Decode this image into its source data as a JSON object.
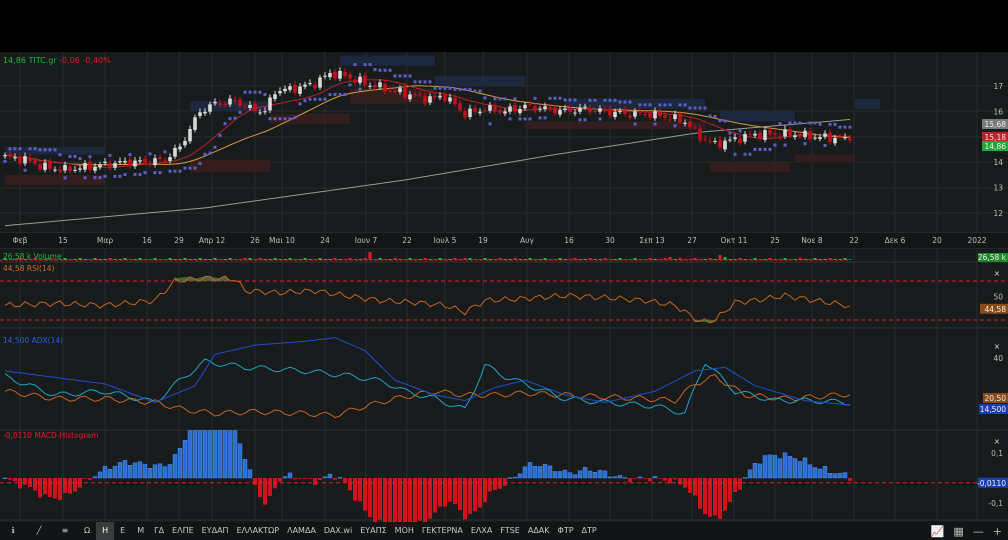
{
  "header": {
    "last": "14,86",
    "symbol": "TITC.gr",
    "change": "-0,06",
    "change_pct": "-0,40%"
  },
  "colors": {
    "up": "#d9d9d9",
    "down": "#c3111b",
    "ma_fast": "#c0202a",
    "ma_mid": "#d99a3a",
    "ma_long": "#9a9a9a",
    "sar": "#5b5fc7",
    "green": "#22b83a",
    "red": "#e0202a",
    "orange": "#c8641e",
    "blue": "#1f4fd0",
    "cyan": "#1fa3c7"
  },
  "chart_data": {
    "type": "candlestick",
    "title": "TITC.gr",
    "x_tick_labels": [
      "Φεβ",
      "15",
      "Μαρ",
      "16",
      "29",
      "Απρ 12",
      "26",
      "Μαι 10",
      "24",
      "Ιουν 7",
      "22",
      "Ιουλ 5",
      "19",
      "Αυγ",
      "16",
      "30",
      "Σεπ 13",
      "27",
      "Οκτ 11",
      "25",
      "Νοε 8",
      "22",
      "Δεκ 6",
      "20",
      "2022"
    ],
    "price_ticks": [
      "17",
      "16",
      "14",
      "13",
      "12"
    ],
    "price_ylim": [
      11.5,
      18.3
    ],
    "n_bars": 170,
    "close_keypoints": [
      [
        0,
        14.2
      ],
      [
        4,
        14.1
      ],
      [
        8,
        13.8
      ],
      [
        12,
        13.7
      ],
      [
        16,
        13.8
      ],
      [
        20,
        13.9
      ],
      [
        24,
        14.0
      ],
      [
        28,
        14.0
      ],
      [
        32,
        14.1
      ],
      [
        35,
        14.6
      ],
      [
        37,
        15.3
      ],
      [
        39,
        16.0
      ],
      [
        42,
        16.3
      ],
      [
        46,
        16.4
      ],
      [
        49,
        16.1
      ],
      [
        52,
        16.0
      ],
      [
        54,
        16.8
      ],
      [
        58,
        16.9
      ],
      [
        62,
        17.1
      ],
      [
        65,
        17.5
      ],
      [
        68,
        17.4
      ],
      [
        72,
        17.1
      ],
      [
        76,
        16.9
      ],
      [
        80,
        16.7
      ],
      [
        84,
        16.5
      ],
      [
        88,
        16.6
      ],
      [
        92,
        15.9
      ],
      [
        96,
        16.1
      ],
      [
        100,
        16.0
      ],
      [
        104,
        16.2
      ],
      [
        108,
        16.1
      ],
      [
        112,
        16.0
      ],
      [
        116,
        16.1
      ],
      [
        120,
        16.0
      ],
      [
        124,
        15.9
      ],
      [
        128,
        15.9
      ],
      [
        132,
        15.8
      ],
      [
        136,
        15.6
      ],
      [
        139,
        15.0
      ],
      [
        142,
        14.7
      ],
      [
        146,
        14.9
      ],
      [
        150,
        15.1
      ],
      [
        154,
        15.1
      ],
      [
        158,
        15.1
      ],
      [
        162,
        15.0
      ],
      [
        166,
        14.95
      ],
      [
        169,
        14.86
      ]
    ],
    "ma_long_keypoints": [
      [
        0,
        11.5
      ],
      [
        40,
        12.2
      ],
      [
        80,
        13.3
      ],
      [
        110,
        14.3
      ],
      [
        140,
        15.2
      ],
      [
        169,
        15.68
      ]
    ],
    "zones_supply": [
      [
        0,
        20,
        14.6,
        14.3
      ],
      [
        37,
        53,
        16.4,
        16.0
      ],
      [
        67,
        86,
        18.2,
        17.8
      ],
      [
        86,
        104,
        17.4,
        17.0
      ],
      [
        112,
        140,
        16.5,
        16.1
      ],
      [
        143,
        158,
        16.0,
        15.6
      ],
      [
        170,
        175,
        16.5,
        16.1
      ]
    ],
    "zones_demand": [
      [
        0,
        20,
        13.5,
        13.1
      ],
      [
        37,
        53,
        14.1,
        13.6
      ],
      [
        53,
        69,
        15.9,
        15.5
      ],
      [
        69,
        86,
        16.9,
        16.3
      ],
      [
        104,
        140,
        15.6,
        15.3
      ],
      [
        141,
        157,
        14.0,
        13.6
      ],
      [
        158,
        170,
        14.3,
        14.0
      ]
    ],
    "price_badges": [
      {
        "value": "15,68",
        "color": "#7a7a7a"
      },
      {
        "value": "15,18",
        "color": "#c0202a"
      },
      {
        "value": "14,86",
        "color": "#22a83a"
      }
    ],
    "volume": {
      "label": "26,58 k Volume",
      "badge": "26,58 k",
      "spikes": [
        [
          73,
          8
        ],
        [
          133,
          3
        ],
        [
          143,
          5
        ],
        [
          144,
          3
        ],
        [
          49,
          2
        ],
        [
          92,
          2
        ]
      ]
    },
    "rsi": {
      "label": "44,58 RSI(14)",
      "badge": "44,58",
      "ticks": [
        "50"
      ],
      "upper": 70,
      "lower": 30,
      "keypoints": [
        [
          0,
          45
        ],
        [
          10,
          47
        ],
        [
          20,
          45
        ],
        [
          30,
          50
        ],
        [
          34,
          70
        ],
        [
          40,
          73
        ],
        [
          46,
          72
        ],
        [
          48,
          60
        ],
        [
          55,
          58
        ],
        [
          62,
          60
        ],
        [
          68,
          55
        ],
        [
          75,
          50
        ],
        [
          82,
          48
        ],
        [
          88,
          45
        ],
        [
          92,
          38
        ],
        [
          96,
          50
        ],
        [
          104,
          52
        ],
        [
          112,
          55
        ],
        [
          120,
          53
        ],
        [
          128,
          50
        ],
        [
          134,
          45
        ],
        [
          139,
          28
        ],
        [
          142,
          30
        ],
        [
          146,
          48
        ],
        [
          150,
          50
        ],
        [
          156,
          55
        ],
        [
          162,
          50
        ],
        [
          169,
          44.58
        ]
      ]
    },
    "adx": {
      "label": "14,500 ADX(14)",
      "ticks": [
        "40"
      ],
      "badges": [
        "20,50",
        "14,500"
      ],
      "adx_keypoints": [
        [
          0,
          33
        ],
        [
          20,
          26
        ],
        [
          30,
          16
        ],
        [
          38,
          25
        ],
        [
          42,
          42
        ],
        [
          50,
          47
        ],
        [
          60,
          49
        ],
        [
          66,
          51
        ],
        [
          72,
          44
        ],
        [
          78,
          28
        ],
        [
          86,
          20
        ],
        [
          92,
          17
        ],
        [
          98,
          24
        ],
        [
          104,
          28
        ],
        [
          112,
          20
        ],
        [
          120,
          16
        ],
        [
          130,
          22
        ],
        [
          138,
          33
        ],
        [
          144,
          35
        ],
        [
          150,
          25
        ],
        [
          160,
          17
        ],
        [
          169,
          14.5
        ]
      ],
      "pdi_keypoints": [
        [
          0,
          30
        ],
        [
          10,
          20
        ],
        [
          20,
          22
        ],
        [
          30,
          16
        ],
        [
          35,
          28
        ],
        [
          40,
          38
        ],
        [
          48,
          35
        ],
        [
          60,
          33
        ],
        [
          70,
          30
        ],
        [
          76,
          27
        ],
        [
          80,
          22
        ],
        [
          86,
          18
        ],
        [
          92,
          12
        ],
        [
          96,
          36
        ],
        [
          100,
          30
        ],
        [
          106,
          24
        ],
        [
          112,
          18
        ],
        [
          120,
          16
        ],
        [
          130,
          14
        ],
        [
          136,
          10
        ],
        [
          140,
          38
        ],
        [
          146,
          22
        ],
        [
          154,
          17
        ],
        [
          160,
          17
        ],
        [
          169,
          16
        ]
      ],
      "mdi_keypoints": [
        [
          0,
          22
        ],
        [
          10,
          18
        ],
        [
          20,
          18
        ],
        [
          30,
          16
        ],
        [
          36,
          12
        ],
        [
          42,
          10
        ],
        [
          50,
          11
        ],
        [
          60,
          10
        ],
        [
          66,
          9
        ],
        [
          72,
          14
        ],
        [
          78,
          18
        ],
        [
          86,
          22
        ],
        [
          92,
          20
        ],
        [
          98,
          20
        ],
        [
          104,
          21
        ],
        [
          112,
          20
        ],
        [
          120,
          19
        ],
        [
          128,
          18
        ],
        [
          134,
          17
        ],
        [
          138,
          26
        ],
        [
          142,
          30
        ],
        [
          148,
          20
        ],
        [
          156,
          18
        ],
        [
          162,
          19
        ],
        [
          169,
          20.5
        ]
      ]
    },
    "macd": {
      "label": "-0,0110 MACD-Histogram",
      "badge": "-0,0110",
      "ticks": [
        "0,1",
        "-0,1"
      ]
    }
  },
  "toolbar": {
    "icons": [
      "info-icon",
      "draw-line-icon",
      "indicators-icon"
    ],
    "periods": [
      "Ω",
      "Η",
      "Ε",
      "Μ"
    ],
    "active_period": "Η",
    "symbols": [
      "ΓΔ",
      "ΕΛΠΕ",
      "ΕΥΔΑΠ",
      "ΕΛΛΑΚΤΩΡ",
      "ΛΑΜΔΑ",
      "DAX.wi",
      "ΕΥΑΠΣ",
      "ΜΟΗ",
      "ΓΕΚΤΕΡΝΑ",
      "ΕΛΧΑ",
      "FTSE",
      "ΑΔΑΚ",
      "ΦΤΡ",
      "ΔΤΡ"
    ]
  }
}
